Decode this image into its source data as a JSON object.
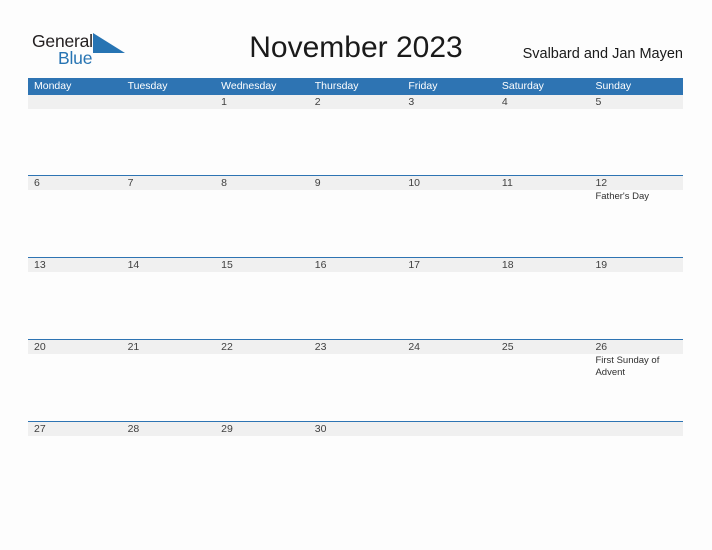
{
  "brand": {
    "name_part1": "General",
    "name_part2": "Blue",
    "accent_color": "#2774b3",
    "triangle_icon": "triangle-icon"
  },
  "header": {
    "title": "November 2023",
    "region": "Svalbard and Jan Mayen"
  },
  "calendar": {
    "month": "November",
    "year": "2023",
    "header_bg_color": "#2e74b3",
    "date_row_bg_color": "#f0f0f0",
    "weekday_headers": [
      "Monday",
      "Tuesday",
      "Wednesday",
      "Thursday",
      "Friday",
      "Saturday",
      "Sunday"
    ],
    "weeks": [
      {
        "days": [
          {
            "date": "",
            "events": []
          },
          {
            "date": "",
            "events": []
          },
          {
            "date": "1",
            "events": []
          },
          {
            "date": "2",
            "events": []
          },
          {
            "date": "3",
            "events": []
          },
          {
            "date": "4",
            "events": []
          },
          {
            "date": "5",
            "events": []
          }
        ]
      },
      {
        "days": [
          {
            "date": "6",
            "events": []
          },
          {
            "date": "7",
            "events": []
          },
          {
            "date": "8",
            "events": []
          },
          {
            "date": "9",
            "events": []
          },
          {
            "date": "10",
            "events": []
          },
          {
            "date": "11",
            "events": []
          },
          {
            "date": "12",
            "events": [
              "Father's Day"
            ]
          }
        ]
      },
      {
        "days": [
          {
            "date": "13",
            "events": []
          },
          {
            "date": "14",
            "events": []
          },
          {
            "date": "15",
            "events": []
          },
          {
            "date": "16",
            "events": []
          },
          {
            "date": "17",
            "events": []
          },
          {
            "date": "18",
            "events": []
          },
          {
            "date": "19",
            "events": []
          }
        ]
      },
      {
        "days": [
          {
            "date": "20",
            "events": []
          },
          {
            "date": "21",
            "events": []
          },
          {
            "date": "22",
            "events": []
          },
          {
            "date": "23",
            "events": []
          },
          {
            "date": "24",
            "events": []
          },
          {
            "date": "25",
            "events": []
          },
          {
            "date": "26",
            "events": [
              "First Sunday of Advent"
            ]
          }
        ]
      },
      {
        "days": [
          {
            "date": "27",
            "events": []
          },
          {
            "date": "28",
            "events": []
          },
          {
            "date": "29",
            "events": []
          },
          {
            "date": "30",
            "events": []
          },
          {
            "date": "",
            "events": []
          },
          {
            "date": "",
            "events": []
          },
          {
            "date": "",
            "events": []
          }
        ]
      }
    ]
  }
}
